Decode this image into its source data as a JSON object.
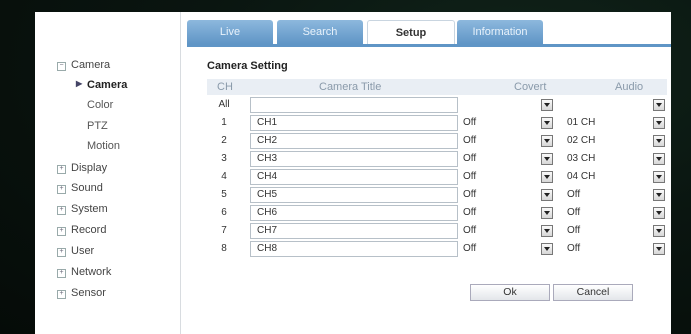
{
  "tabs": [
    {
      "label": "Live"
    },
    {
      "label": "Search"
    },
    {
      "label": "Setup"
    },
    {
      "label": "Information"
    }
  ],
  "sidebar": {
    "camera": "Camera",
    "sub": [
      "Camera",
      "Color",
      "PTZ",
      "Motion"
    ],
    "groups": [
      "Display",
      "Sound",
      "System",
      "Record",
      "User",
      "Network",
      "Sensor"
    ]
  },
  "section_title": "Camera Setting",
  "columns": {
    "ch": "CH",
    "title": "Camera Title",
    "covert": "Covert",
    "audio": "Audio"
  },
  "all_row": {
    "ch": "All",
    "title": "",
    "covert": "",
    "audio": ""
  },
  "rows": [
    {
      "ch": "1",
      "title": "CH1",
      "covert": "Off",
      "audio": "01  CH"
    },
    {
      "ch": "2",
      "title": "CH2",
      "covert": "Off",
      "audio": "02  CH"
    },
    {
      "ch": "3",
      "title": "CH3",
      "covert": "Off",
      "audio": "03  CH"
    },
    {
      "ch": "4",
      "title": "CH4",
      "covert": "Off",
      "audio": "04  CH"
    },
    {
      "ch": "5",
      "title": "CH5",
      "covert": "Off",
      "audio": "Off"
    },
    {
      "ch": "6",
      "title": "CH6",
      "covert": "Off",
      "audio": "Off"
    },
    {
      "ch": "7",
      "title": "CH7",
      "covert": "Off",
      "audio": "Off"
    },
    {
      "ch": "8",
      "title": "CH8",
      "covert": "Off",
      "audio": "Off"
    }
  ],
  "buttons": {
    "ok": "Ok",
    "cancel": "Cancel"
  }
}
